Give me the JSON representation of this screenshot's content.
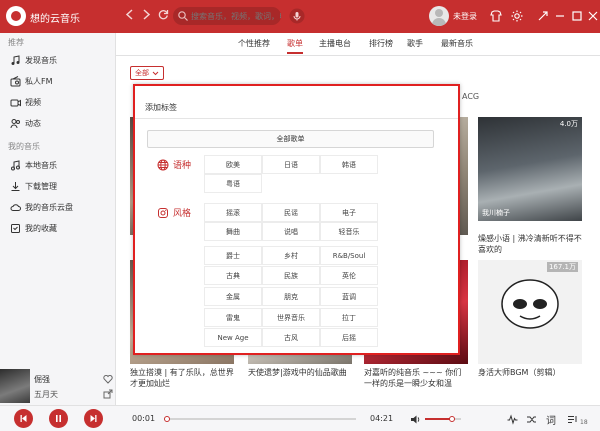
{
  "app": {
    "title": "想的云音乐",
    "brand_color": "#c62f2f"
  },
  "topbar": {
    "back_icon": "chevron-left-icon",
    "forward_icon": "chevron-right-icon",
    "refresh_icon": "refresh-icon",
    "search_placeholder": "搜索音乐，视频，歌词，电台...",
    "login_label": "未登录"
  },
  "sidebar": {
    "section_recommend": "推荐",
    "recommend_items": [
      {
        "label": "发现音乐",
        "icon": "music-note-icon"
      },
      {
        "label": "私人FM",
        "icon": "radio-icon"
      },
      {
        "label": "视频",
        "icon": "video-icon"
      },
      {
        "label": "动态",
        "icon": "friends-icon"
      }
    ],
    "section_my_music": "我的音乐",
    "my_music_items": [
      {
        "label": "本地音乐",
        "icon": "local-music-icon"
      },
      {
        "label": "下载管理",
        "icon": "download-icon"
      },
      {
        "label": "我的音乐云盘",
        "icon": "cloud-icon"
      },
      {
        "label": "我的收藏",
        "icon": "favorites-icon"
      }
    ]
  },
  "tabs": [
    {
      "label": "个性推荐",
      "active": false
    },
    {
      "label": "歌单",
      "active": true
    },
    {
      "label": "主播电台",
      "active": false
    },
    {
      "label": "排行榜",
      "active": false
    },
    {
      "label": "歌手",
      "active": false
    },
    {
      "label": "最新音乐",
      "active": false
    }
  ],
  "filter": {
    "label": "全部"
  },
  "background_labels": {
    "acg": "ACG"
  },
  "cards": [
    {
      "count": "4.0万",
      "owner": "我川楠子"
    },
    {
      "count": "167.1万",
      "owner": ""
    }
  ],
  "captions": [
    "独立搭漠 | 有了乐队，总世界才更加灿烂",
    "天使遗梦|游戏中的仙品歌曲",
    "对嘉听的纯音乐 ~~~ 你们一样的乐是一瞬少女和温",
    "燥感小语 | 沸冷清新听不得不喜欢的",
    "身活大师BGM（剪辑）"
  ],
  "modal": {
    "title": "添加标签",
    "all_button": "全部歌单",
    "sections": [
      {
        "label": "语种",
        "icon": "globe-icon",
        "tags": [
          "欧美",
          "日语",
          "韩语",
          "粤语"
        ]
      },
      {
        "label": "风格",
        "icon": "style-icon",
        "tags": [
          "摇滚",
          "民谣",
          "电子",
          "舞曲",
          "说唱",
          "轻音乐",
          "爵士",
          "乡村",
          "R&B/Soul",
          "古典",
          "民族",
          "英伦",
          "金属",
          "朋克",
          "蓝调",
          "雷鬼",
          "世界音乐",
          "拉丁",
          "New Age",
          "古风",
          "后摇"
        ]
      }
    ]
  },
  "now_playing": {
    "title": "倔强",
    "artist": "五月天"
  },
  "player": {
    "current_time": "00:01",
    "total_time": "04:21",
    "progress": 0.01,
    "volume": 0.75,
    "lyric_label": "词",
    "playlist_count": "18"
  }
}
